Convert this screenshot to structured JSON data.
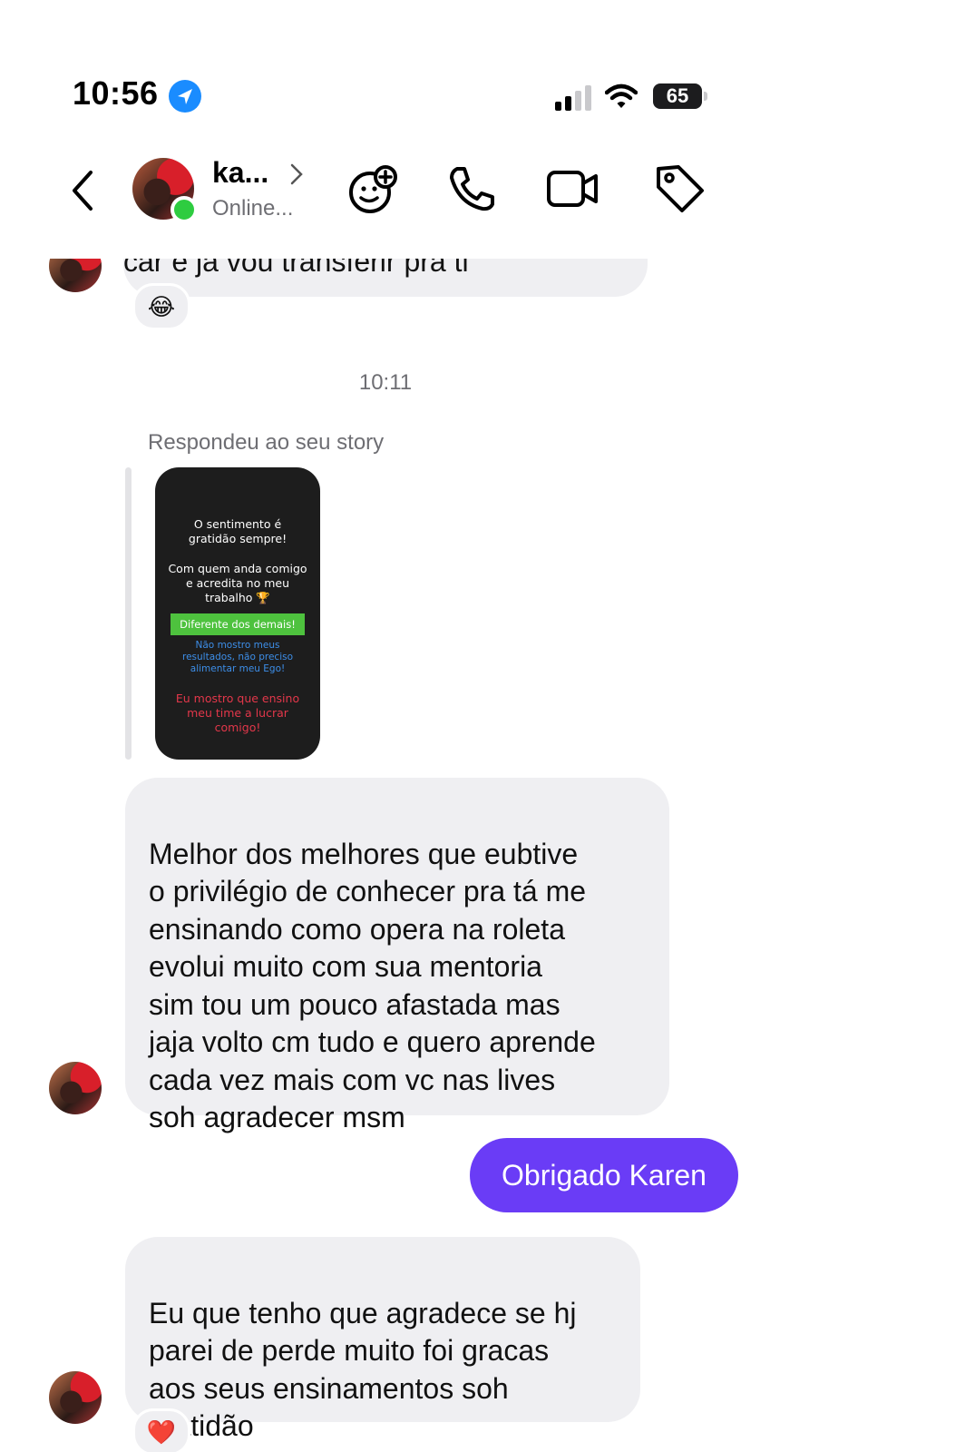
{
  "status_bar": {
    "time": "10:56",
    "battery": "65"
  },
  "header": {
    "name": "ka...",
    "status": "Online..."
  },
  "messages": {
    "prev_partial": "car e já vou transferir pra ti",
    "reaction_laugh": "😂",
    "timestamp": "10:11",
    "reply_label": "Respondeu ao seu story",
    "story": {
      "line1": "O sentimento é\ngratidão sempre!",
      "line2": "Com quem anda comigo\ne acredita no meu\ntrabalho 🏆",
      "green": "Diferente dos demais!",
      "blue": "Não mostro meus\nresultados, não preciso\nalimentar meu Ego!",
      "red": "Eu mostro que ensino\nmeu time a lucrar\ncomigo!"
    },
    "incoming_1": "Melhor dos melhores que eubtive\no privilégio de conhecer  pra tá me\nensinando  como opera na roleta\nevolui muito com sua mentoria\nsim tou um pouco afastada mas\njaja volto cm tudo e quero aprende\ncada vez mais com vc nas lives\nsoh agradecer  msm",
    "outgoing_1": "Obrigado Karen",
    "incoming_2": "Eu que tenho que agradece se hj\nparei de perde muito foi gracas\naos seus ensinamentos  soh\ngratidão",
    "reaction_heart": "❤️"
  },
  "colors": {
    "outgoing_bubble": "#6a3cf6",
    "incoming_bubble": "#efeff2",
    "online": "#2ecc40"
  }
}
